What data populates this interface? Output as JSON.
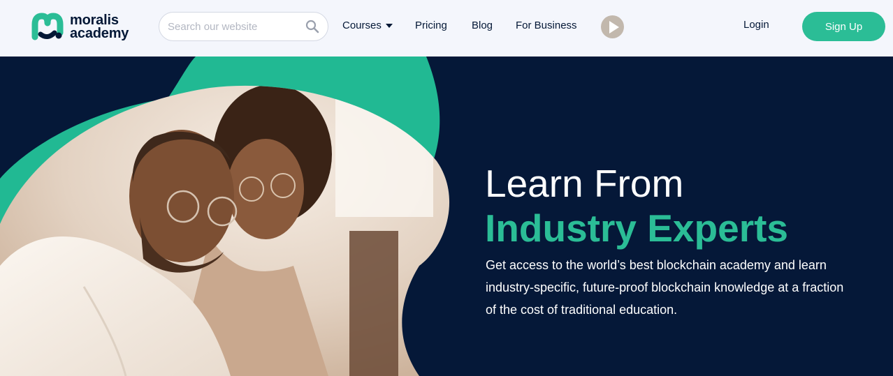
{
  "brand": {
    "line1": "moralis",
    "line2": "academy",
    "accent_color": "#2bbd96",
    "dark_color": "#041836"
  },
  "search": {
    "placeholder": "Search our website",
    "value": "",
    "icon": "search-icon"
  },
  "nav": {
    "courses": "Courses",
    "pricing": "Pricing",
    "blog": "Blog",
    "for_business": "For Business",
    "play_icon": "play-icon"
  },
  "auth": {
    "login": "Login",
    "signup": "Sign Up"
  },
  "hero": {
    "title": "Learn From",
    "highlight": "Industry Experts",
    "description": "Get access to the world’s best blockchain academy and learn industry-specific, future-proof blockchain knowledge at a fraction of the cost of traditional education.",
    "background_color": "#051838",
    "highlight_color": "#2bbd96"
  }
}
